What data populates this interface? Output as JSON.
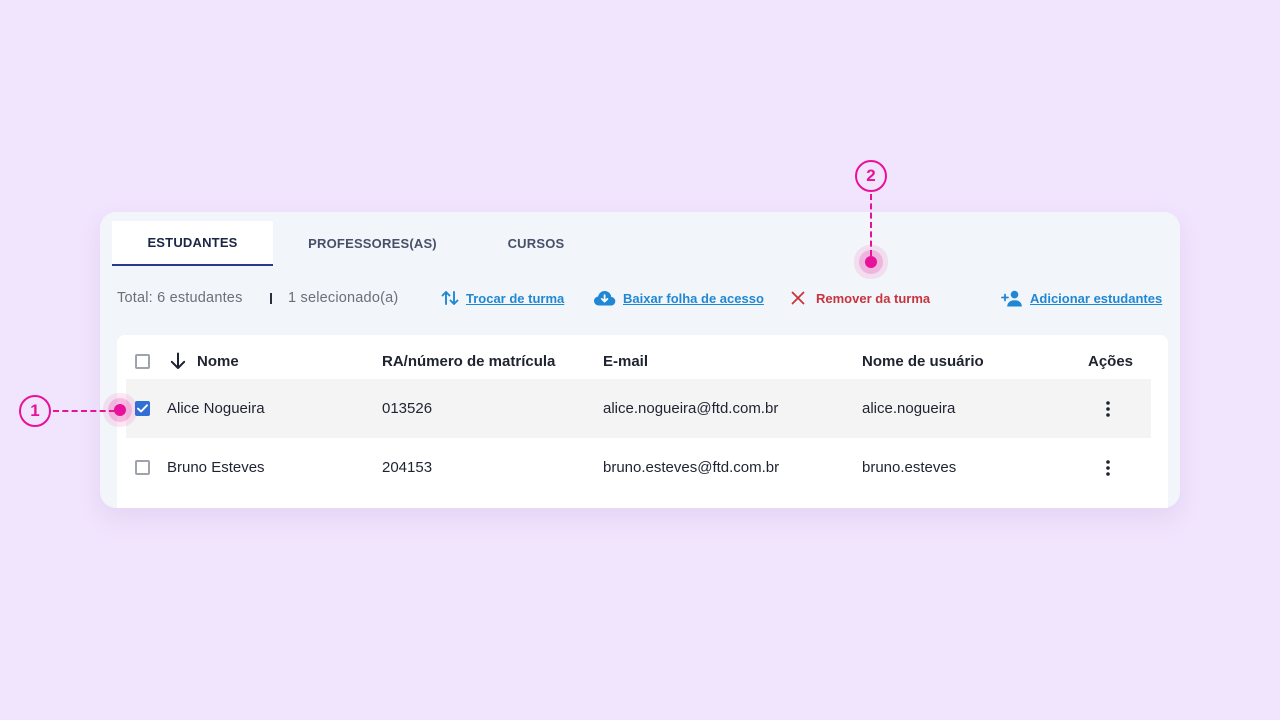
{
  "tabs": [
    {
      "label": "ESTUDANTES",
      "active": true
    },
    {
      "label": "PROFESSORES(AS)",
      "active": false
    },
    {
      "label": "CURSOS",
      "active": false
    }
  ],
  "toolbar": {
    "total": "Total: 6 estudantes",
    "selected": "1 selecionado(a)",
    "change_class": "Trocar de turma",
    "download_sheet": "Baixar folha de acesso",
    "remove_from_class": "Remover da turma",
    "add_students": "Adicionar estudantes"
  },
  "table": {
    "columns": {
      "name": "Nome",
      "ra": "RA/número de matrícula",
      "email": "E-mail",
      "username": "Nome de usuário",
      "actions": "Ações"
    },
    "sort_icon": "arrow-down-icon",
    "rows": [
      {
        "selected": true,
        "name": "Alice Nogueira",
        "ra": "013526",
        "email": "alice.nogueira@ftd.com.br",
        "username": "alice.nogueira"
      },
      {
        "selected": false,
        "name": "Bruno Esteves",
        "ra": "204153",
        "email": "bruno.esteves@ftd.com.br",
        "username": "bruno.esteves"
      }
    ]
  },
  "annotations": [
    {
      "label": "1"
    },
    {
      "label": "2"
    }
  ],
  "colors": {
    "background": "#F1E4FD",
    "card": "#F2F5F9",
    "link_blue": "#1f88d4",
    "danger_red": "#c8343e",
    "checkbox_blue": "#2f6fd6",
    "annotation_pink": "#E8129A",
    "active_tab_border": "#283a8c"
  }
}
